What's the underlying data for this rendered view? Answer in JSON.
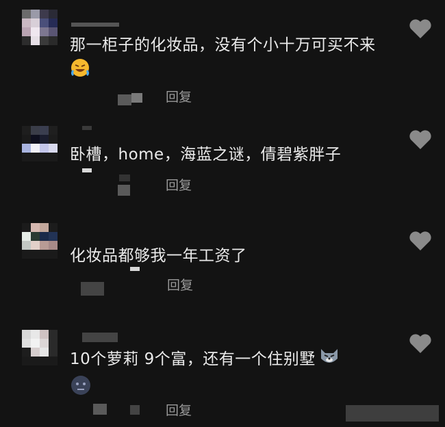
{
  "comments": [
    {
      "text": "那一柜子的化妆品，没有个小十万可买不来",
      "emoji": "rofl-emoji",
      "reply_label": "回复"
    },
    {
      "text": "卧槽，home，海蓝之谜，倩碧紫胖子",
      "reply_label": "回复"
    },
    {
      "text": "化妆品都够我一年工资了",
      "reply_label": "回复"
    },
    {
      "text": "10个萝莉 9个富，还有一个住别墅",
      "emoji": "wolf-emoji",
      "emoji2": "dark-face-emoji",
      "reply_label": "回复"
    }
  ],
  "colors": {
    "background": "#131313",
    "text": "#eaeaea",
    "reply": "#9a9a9a",
    "heart": "#8a8a8a"
  }
}
